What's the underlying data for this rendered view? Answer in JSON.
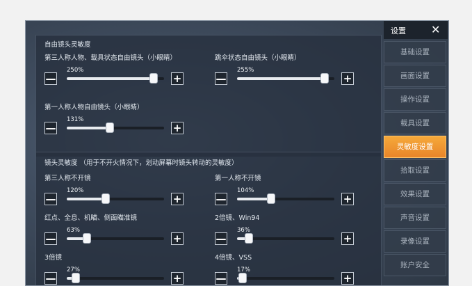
{
  "sidebar": {
    "title": "设置",
    "close_glyph": "✕",
    "items": [
      {
        "label": "基础设置",
        "active": false
      },
      {
        "label": "画面设置",
        "active": false
      },
      {
        "label": "操作设置",
        "active": false
      },
      {
        "label": "载具设置",
        "active": false
      },
      {
        "label": "灵敏度设置",
        "active": true
      },
      {
        "label": "拾取设置",
        "active": false
      },
      {
        "label": "效果设置",
        "active": false
      },
      {
        "label": "声音设置",
        "active": false
      },
      {
        "label": "录像设置",
        "active": false
      },
      {
        "label": "账户安全",
        "active": false
      }
    ]
  },
  "free_camera": {
    "title": "自由镜头灵敏度",
    "settings": [
      {
        "label": "第三人称人物、载具状态自由镜头（小眼睛）",
        "value": "250%",
        "fraction": 0.89
      },
      {
        "label": "跳伞状态自由镜头（小眼睛）",
        "value": "255%",
        "fraction": 0.9
      },
      {
        "label": "第一人称人物自由镜头（小眼睛）",
        "value": "131%",
        "fraction": 0.44
      }
    ]
  },
  "camera": {
    "title": "镜头灵敏度 （用于不开火情况下，划动屏幕时镜头转动的灵敏度）",
    "settings": [
      {
        "label": "第三人称不开镜",
        "value": "120%",
        "fraction": 0.4
      },
      {
        "label": "第一人称不开镜",
        "value": "104%",
        "fraction": 0.35
      },
      {
        "label": "红点、全息、机瞄、侧面瞄准镜",
        "value": "63%",
        "fraction": 0.21
      },
      {
        "label": "2倍镜、Win94",
        "value": "36%",
        "fraction": 0.12
      },
      {
        "label": "3倍镜",
        "value": "27%",
        "fraction": 0.09
      },
      {
        "label": "4倍镜、VSS",
        "value": "17%",
        "fraction": 0.06
      }
    ]
  },
  "button_glyphs": {
    "minus": "—",
    "plus": "+"
  },
  "colors": {
    "accent": "#f0952f",
    "panel": "#2b3644",
    "sidebar_header": "#1c232c"
  }
}
